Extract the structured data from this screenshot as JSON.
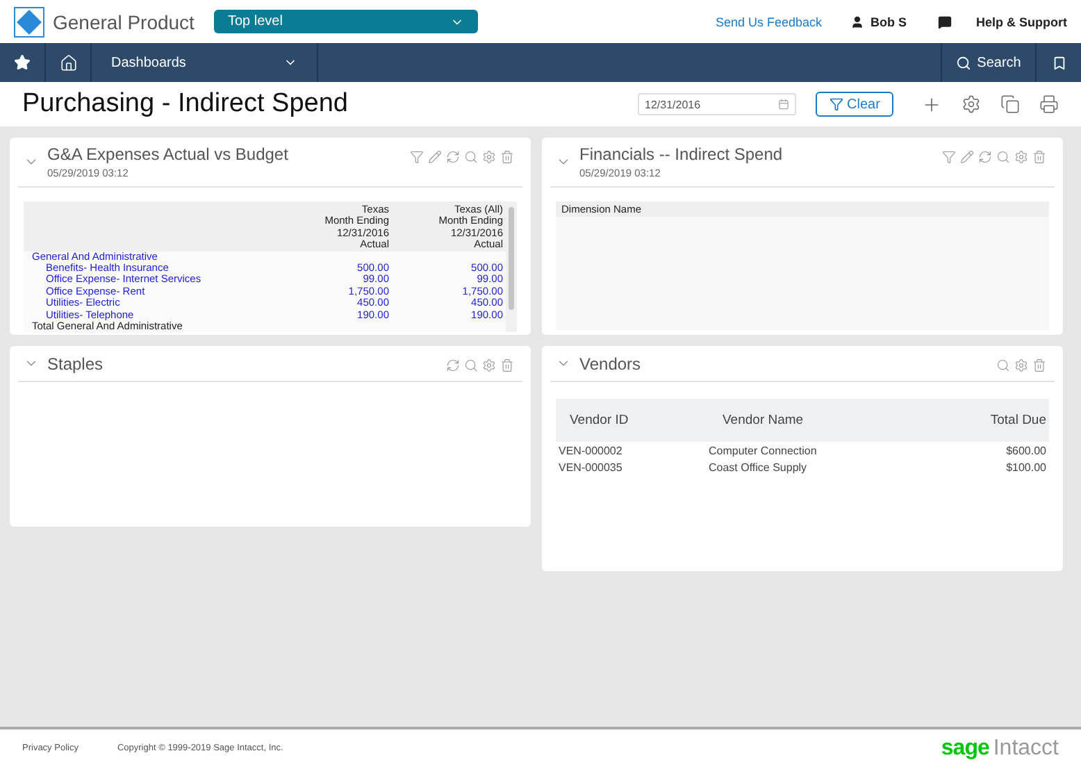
{
  "header": {
    "app_name": "General Product",
    "entity_select": "Top level",
    "feedback_link": "Send Us Feedback",
    "user": "Bob S",
    "help": "Help & Support"
  },
  "nav": {
    "menu": "Dashboards",
    "search": "Search"
  },
  "page": {
    "title": "Purchasing - Indirect Spend",
    "date_value": "12/31/2016",
    "clear_button": "Clear"
  },
  "panels": [
    {
      "kind": "report",
      "title": "G&A Expenses Actual vs Budget",
      "timestamp": "05/29/2019 03:12",
      "expanded": true,
      "tools": [
        {
          "kind": "filter"
        },
        {
          "kind": "edit"
        },
        {
          "kind": "refresh"
        },
        {
          "kind": "search"
        },
        {
          "kind": "settings"
        },
        {
          "kind": "delete"
        }
      ],
      "columns": [
        [
          "Texas",
          "Month Ending",
          "12/31/2016",
          "Actual"
        ],
        [
          "Texas (All)",
          "Month Ending",
          "12/31/2016",
          "Actual"
        ]
      ],
      "rows": [
        {
          "label": "General And Administrative",
          "values": [],
          "children": [
            {
              "label": "Benefits- Health Insurance",
              "values": [
                "500.00",
                "500.00"
              ]
            },
            {
              "label": "Office Expense- Internet Services",
              "values": [
                "99.00",
                "99.00"
              ]
            },
            {
              "label": "Office Expense- Rent",
              "values": [
                "1,750.00",
                "1,750.00"
              ]
            },
            {
              "label": "Utilities- Electric",
              "values": [
                "450.00",
                "450.00"
              ]
            },
            {
              "label": "Utilities- Telephone",
              "values": [
                "190.00",
                "190.00"
              ]
            }
          ]
        },
        {
          "label": "Total General And Administrative",
          "kind": "total",
          "values": []
        }
      ]
    },
    {
      "kind": "dimension",
      "title": "Financials -- Indirect Spend",
      "timestamp": "05/29/2019 03:12",
      "expanded": true,
      "tools": [
        {
          "kind": "filter"
        },
        {
          "kind": "edit"
        },
        {
          "kind": "refresh"
        },
        {
          "kind": "search"
        },
        {
          "kind": "settings"
        },
        {
          "kind": "delete"
        }
      ],
      "column": "Dimension Name"
    },
    {
      "kind": "empty",
      "title": "Staples",
      "expanded": true,
      "tools": [
        {
          "kind": "refresh"
        },
        {
          "kind": "search"
        },
        {
          "kind": "settings"
        },
        {
          "kind": "delete"
        }
      ]
    },
    {
      "kind": "table",
      "title": "Vendors",
      "expanded": true,
      "tools": [
        {
          "kind": "search"
        },
        {
          "kind": "settings"
        },
        {
          "kind": "delete"
        }
      ],
      "columns": [
        "Vendor ID",
        "Vendor Name",
        "Total Due"
      ],
      "rows": [
        [
          "VEN-000002",
          "Computer Connection",
          "$600.00"
        ],
        [
          "VEN-000035",
          "Coast Office Supply",
          "$100.00"
        ]
      ]
    }
  ],
  "footer": {
    "privacy": "Privacy Policy",
    "copyright": "Copyright © 1999-2019 Sage Intacct, Inc.",
    "logo_brand": "sage",
    "logo_product": "Intacct"
  }
}
